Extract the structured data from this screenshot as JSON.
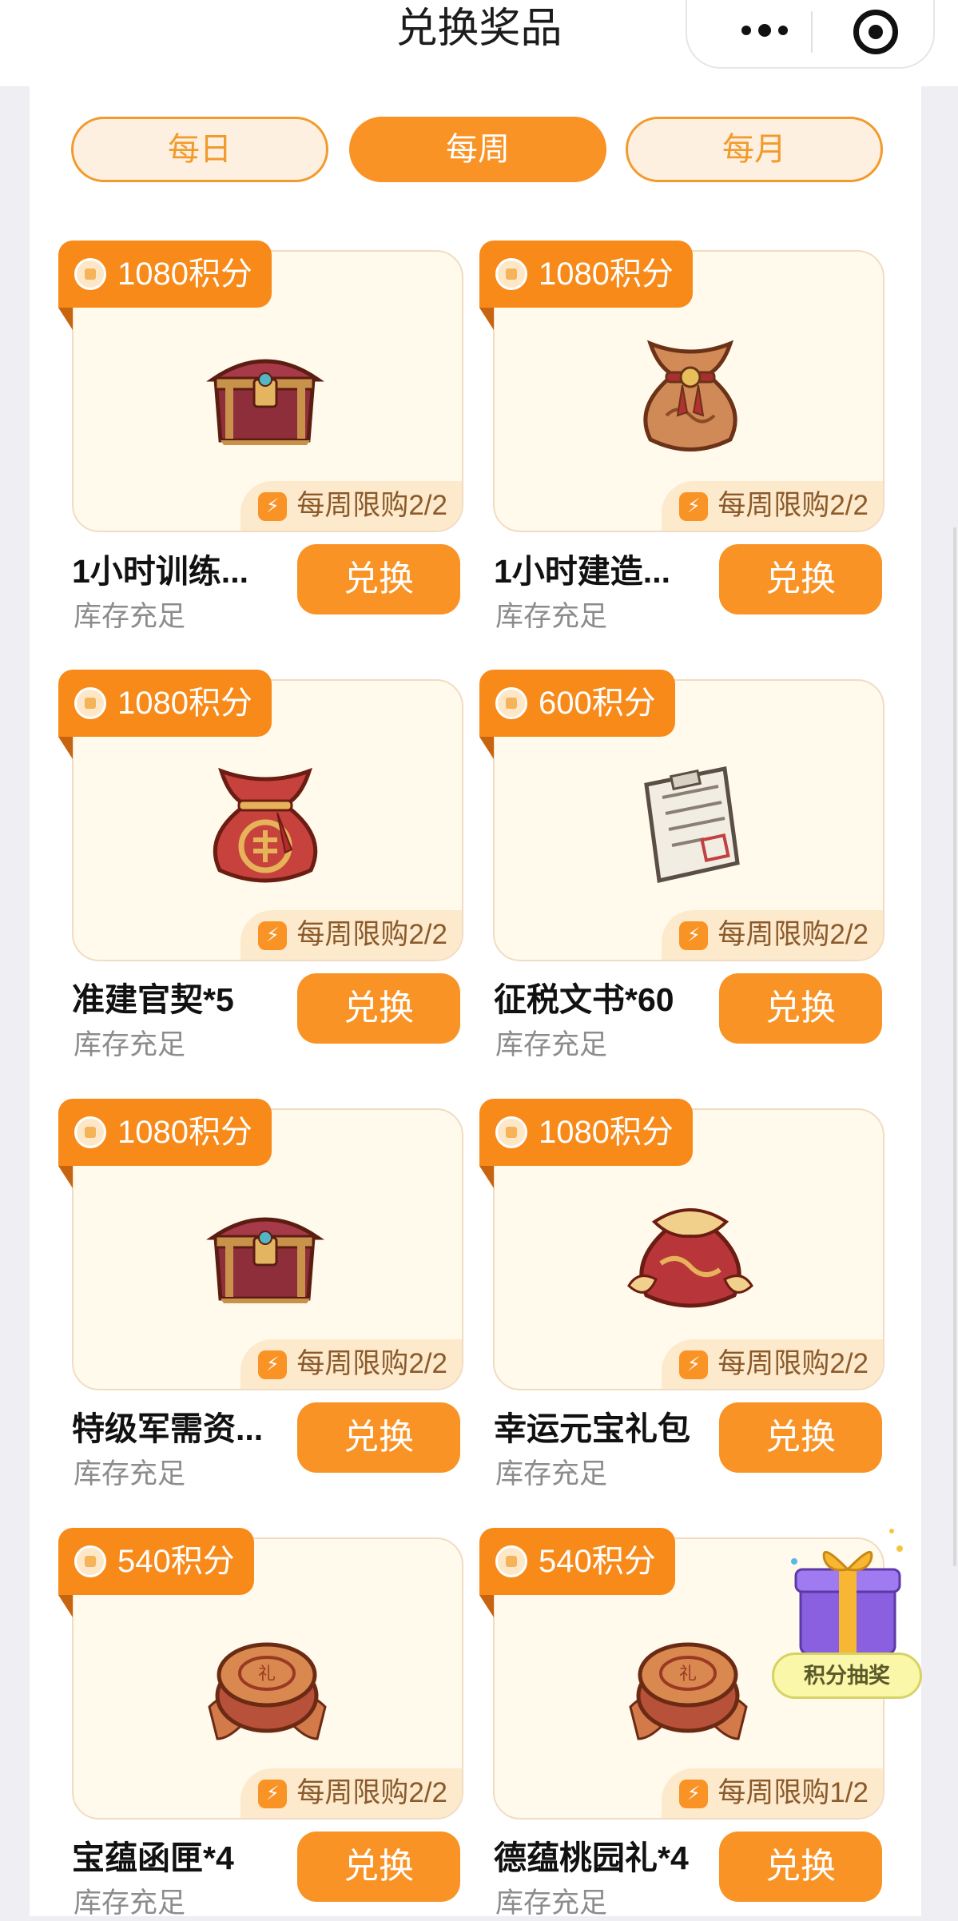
{
  "header": {
    "title": "兑换奖品"
  },
  "tabs": [
    {
      "label": "每日",
      "active": false
    },
    {
      "label": "每周",
      "active": true
    },
    {
      "label": "每月",
      "active": false
    }
  ],
  "items": [
    {
      "points": "1080积分",
      "limit": "每周限购2/2",
      "name": "1小时训练...",
      "stock": "库存充足",
      "button": "兑换",
      "icon": "treasure-chest-icon"
    },
    {
      "points": "1080积分",
      "limit": "每周限购2/2",
      "name": "1小时建造...",
      "stock": "库存充足",
      "button": "兑换",
      "icon": "brown-pouch-icon"
    },
    {
      "points": "1080积分",
      "limit": "每周限购2/2",
      "name": "准建官契*5",
      "stock": "库存充足",
      "button": "兑换",
      "icon": "red-pouch-icon"
    },
    {
      "points": "600积分",
      "limit": "每周限购2/2",
      "name": "征税文书*60",
      "stock": "库存充足",
      "button": "兑换",
      "icon": "document-scroll-icon"
    },
    {
      "points": "1080积分",
      "limit": "每周限购2/2",
      "name": "特级军需资...",
      "stock": "库存充足",
      "button": "兑换",
      "icon": "treasure-chest-icon"
    },
    {
      "points": "1080积分",
      "limit": "每周限购2/2",
      "name": "幸运元宝礼包",
      "stock": "库存充足",
      "button": "兑换",
      "icon": "ingot-bag-icon"
    },
    {
      "points": "540积分",
      "limit": "每周限购2/2",
      "name": "宝蕴函匣*4",
      "stock": "库存充足",
      "button": "兑换",
      "icon": "gift-box-icon"
    },
    {
      "points": "540积分",
      "limit": "每周限购1/2",
      "name": "德蕴桃园礼*4",
      "stock": "库存充足",
      "button": "兑换",
      "icon": "gift-box-icon"
    }
  ],
  "floating": {
    "lottery_label": "积分抽奖"
  },
  "colors": {
    "accent": "#f99325",
    "card_bg": "#fffaeb",
    "limit_bg": "#fde9cc"
  }
}
